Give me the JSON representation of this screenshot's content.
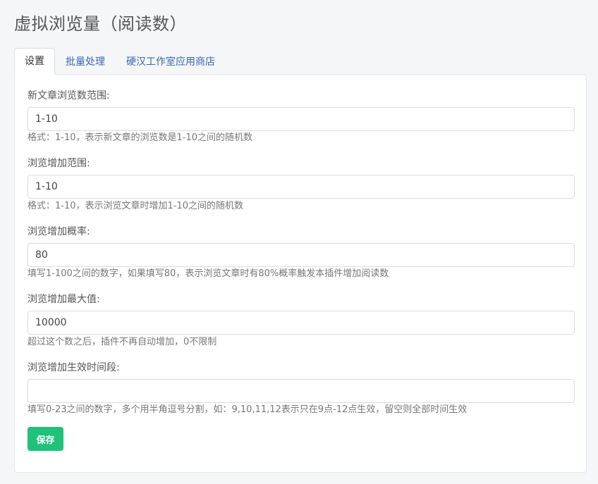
{
  "page": {
    "title": "虚拟浏览量（阅读数）"
  },
  "tabs": [
    {
      "label": "设置",
      "active": true
    },
    {
      "label": "批量处理",
      "active": false
    },
    {
      "label": "硬汉工作室应用商店",
      "active": false
    }
  ],
  "form": {
    "fields": [
      {
        "label": "新文章浏览数范围:",
        "value": "1-10",
        "placeholder": "",
        "help": "格式：1-10，表示新文章的浏览数是1-10之间的随机数"
      },
      {
        "label": "浏览增加范围:",
        "value": "1-10",
        "placeholder": "",
        "help": "格式：1-10，表示浏览文章时增加1-10之间的随机数"
      },
      {
        "label": "浏览增加概率:",
        "value": "80",
        "placeholder": "",
        "help": "填写1-100之间的数字，如果填写80，表示浏览文章时有80%概率触发本插件增加阅读数"
      },
      {
        "label": "浏览增加最大值:",
        "value": "10000",
        "placeholder": "",
        "help": "超过这个数之后，插件不再自动增加，0不限制"
      },
      {
        "label": "浏览增加生效时间段:",
        "value": "",
        "placeholder": "",
        "help": "填写0-23之间的数字，多个用半角逗号分割，如：9,10,11,12表示只在9点-12点生效，留空则全部时间生效"
      }
    ],
    "save_label": "保存"
  },
  "colors": {
    "accent": "#1fc17b",
    "link": "#3a68b0",
    "background": "#f5f6f8"
  }
}
